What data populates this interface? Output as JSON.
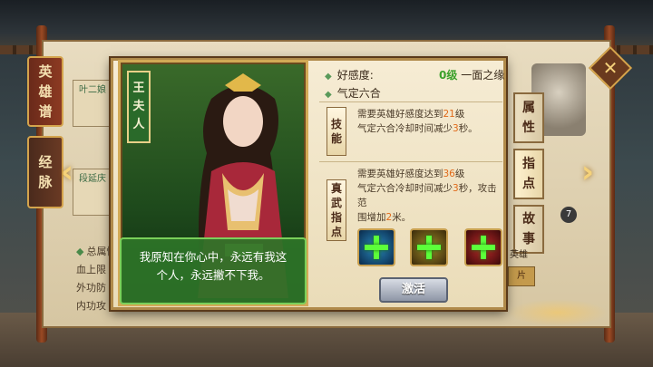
{
  "left_tabs": [
    {
      "label": "英雄谱",
      "chars": [
        "英",
        "雄",
        "谱"
      ]
    },
    {
      "label": "经脉",
      "chars": [
        "经",
        "脉"
      ]
    }
  ],
  "side_stubs": [
    {
      "text": "叶二娘"
    },
    {
      "text": "段延庆"
    }
  ],
  "stats": {
    "header": "总属性",
    "lines": [
      "血上限",
      "外功防",
      "内功攻"
    ]
  },
  "right_tabs": [
    {
      "label": "属性",
      "chars": [
        "属",
        "性"
      ]
    },
    {
      "label": "指点",
      "chars": [
        "指",
        "点"
      ]
    },
    {
      "label": "故事",
      "chars": [
        "故",
        "事"
      ]
    }
  ],
  "right_badge": "7",
  "right_stub_text": "英雄",
  "right_stub_button": "片",
  "hero": {
    "name": "王夫人",
    "name_chars": [
      "王",
      "夫",
      "人"
    ],
    "quote": "我原知在你心中，永远有我这个人，永远撇不下我。"
  },
  "favor": {
    "label": "好感度:",
    "level_value": "0级",
    "level_name": "一面之缘"
  },
  "skill": {
    "name": "气定六合"
  },
  "categories": {
    "skill": {
      "label": "技能",
      "chars": [
        "技",
        "能"
      ]
    },
    "zhenwu": {
      "label": "真武指点",
      "chars": [
        "真",
        "武",
        "指",
        "点"
      ]
    }
  },
  "requirements": [
    {
      "line1_prefix": "需要英雄好感度达到",
      "line1_value": "21",
      "line1_suffix": "级",
      "line2_prefix": "气定六合冷却时间减少",
      "line2_value": "3",
      "line2_suffix": "秒。"
    },
    {
      "line1_prefix": "需要英雄好感度达到",
      "line1_value": "36",
      "line1_suffix": "级",
      "line2_prefix": "气定六合冷却时间减少",
      "line2_value": "3",
      "line2_suffix": "秒，攻击范",
      "line3_prefix": "围增加",
      "line3_value": "2",
      "line3_suffix": "米。"
    }
  ],
  "slots": [
    {
      "icon": "plus-icon",
      "color": "#2a8ac0"
    },
    {
      "icon": "plus-icon",
      "color": "#a08a2a"
    },
    {
      "icon": "plus-icon",
      "color": "#c02a2a"
    }
  ],
  "activate_button": "激活",
  "colors": {
    "accent_green": "#3aa02a",
    "highlight_orange": "#e06a1a",
    "frame_gold": "#d2aa56"
  }
}
